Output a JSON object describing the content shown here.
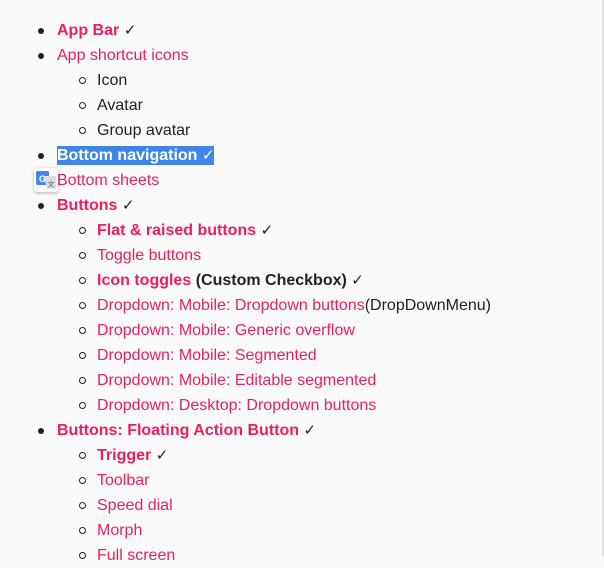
{
  "checkmark": "✓",
  "items": [
    {
      "label": "App Bar",
      "done": true
    },
    {
      "label": "App shortcut icons",
      "children": [
        "Icon",
        "Avatar",
        "Group avatar"
      ]
    },
    {
      "label": "Bottom navigation",
      "done": true,
      "selected": true
    },
    {
      "label": "Bottom sheets"
    },
    {
      "label": "Buttons",
      "done": true,
      "children": [
        {
          "label": "Flat & raised buttons",
          "done": true
        },
        {
          "label": "Toggle buttons"
        },
        {
          "label": "Icon toggles",
          "suffix": "(Custom Checkbox)",
          "done": true
        },
        {
          "label": "Dropdown: Mobile: Dropdown buttons",
          "suffix": "(DropDownMenu)"
        },
        {
          "label": "Dropdown: Mobile: Generic overflow"
        },
        {
          "label": "Dropdown: Mobile: Segmented"
        },
        {
          "label": "Dropdown: Mobile: Editable segmented"
        },
        {
          "label": "Dropdown: Desktop: Dropdown buttons"
        }
      ]
    },
    {
      "label": "Buttons: Floating Action Button",
      "done": true,
      "children": [
        {
          "label": "Trigger",
          "done": true
        },
        {
          "label": "Toolbar"
        },
        {
          "label": "Speed dial"
        },
        {
          "label": "Morph"
        },
        {
          "label": "Full screen"
        }
      ]
    }
  ],
  "colors": {
    "link": "#e91e63",
    "text": "#212121",
    "selection": "#3f86e8",
    "background": "#fafafa"
  },
  "icons": {
    "translate": "google-translate-icon"
  }
}
